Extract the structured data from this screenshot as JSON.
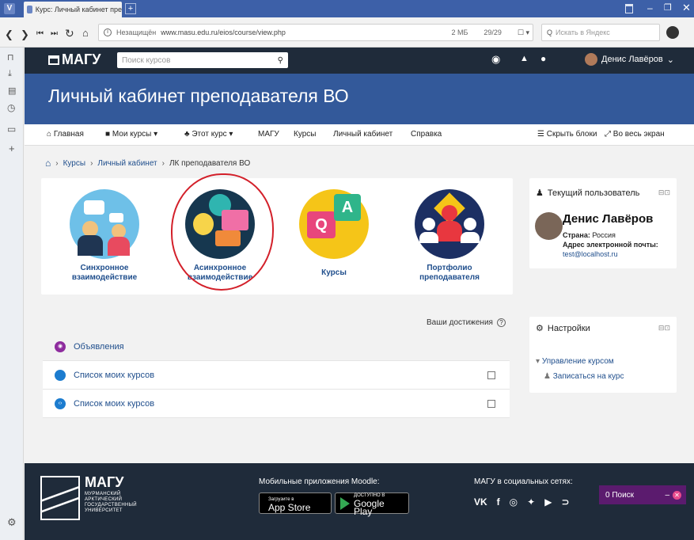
{
  "browser": {
    "tab_title": "Курс: Личный кабинет пре",
    "url_label": "Незащищён",
    "url": "www.masu.edu.ru/eios/course/view.php",
    "size": "2 МБ",
    "page_count": "29/29",
    "search_placeholder": "Искать в Яндекс",
    "zoom": "100"
  },
  "topnav": {
    "logo": "МАГУ",
    "search_placeholder": "Поиск курсов",
    "user_name": "Денис Лавёров"
  },
  "header": {
    "title": "Личный кабинет преподавателя ВО"
  },
  "menu": {
    "home": "Главная",
    "my_courses": "Мои курсы",
    "this_course": "Этот курс",
    "magu": "МАГУ",
    "courses": "Курсы",
    "cabinet": "Личный кабинет",
    "help": "Справка",
    "hide_blocks": "Скрыть блоки",
    "fullscreen": "Во весь экран"
  },
  "breadcrumb": {
    "courses": "Курсы",
    "cabinet": "Личный кабинет",
    "current": "ЛК преподавателя ВО"
  },
  "tiles": [
    {
      "label": "Синхронное взаимодействие"
    },
    {
      "label": "Асинхронное взаимодействие"
    },
    {
      "label": "Курсы"
    },
    {
      "label": "Портфолио преподавателя"
    }
  ],
  "achievements": "Ваши достижения",
  "sections": [
    {
      "title": "Объявления"
    },
    {
      "title": "Список моих курсов"
    },
    {
      "title": "Список моих курсов"
    }
  ],
  "current_user_block": {
    "title": "Текущий пользователь",
    "name": "Денис Лавёров",
    "country_label": "Страна:",
    "country": "Россия",
    "email_label": "Адрес электронной почты:",
    "email": "test@localhost.ru"
  },
  "settings_block": {
    "title": "Настройки",
    "manage": "Управление курсом",
    "enrol": "Записаться на курс"
  },
  "footer": {
    "logo": "МАГУ",
    "university": "МУРМАНСКИЙ АРКТИЧЕСКИЙ ГОСУДАРСТВЕННЫЙ УНИВЕРСИТЕТ",
    "apps_title": "Мобильные приложения Moodle:",
    "appstore_small": "Загрузите в",
    "appstore": "App Store",
    "googleplay_small": "ДОСТУПНО В",
    "googleplay": "Google Play",
    "social_title": "МАГУ в социальных сетях:",
    "search_widget": "0 Поиск"
  },
  "colors": {
    "navbar": "#1f2b3a",
    "header": "#33599a",
    "link": "#1f4e8c",
    "search_widget": "#5b1b6e"
  }
}
